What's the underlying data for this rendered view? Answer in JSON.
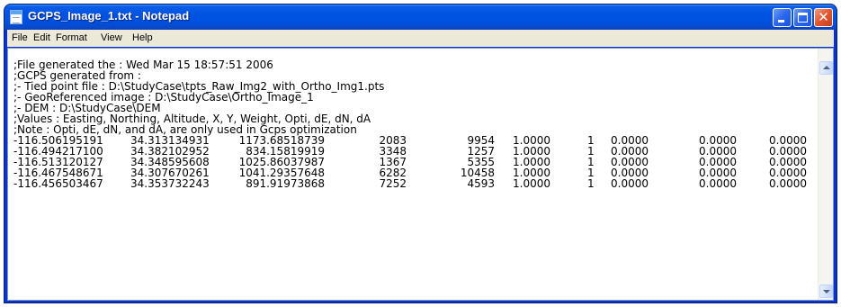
{
  "window": {
    "title": "GCPS_Image_1.txt - Notepad"
  },
  "menu": [
    "File",
    "Edit",
    "Format",
    "View",
    "Help"
  ],
  "document": {
    "header_lines": [
      ";File generated the : Wed Mar 15 18:57:51 2006",
      ";GCPS generated from :",
      ";- Tied point file : D:\\StudyCase\\tpts_Raw_Img2_with_Ortho_Img1.pts",
      ";- GeoReferenced image : D:\\StudyCase\\Ortho_Image_1",
      ";- DEM : D:\\StudyCase\\DEM",
      ";Values : Easting, Northing, Altitude, X, Y, Weight, Opti, dE, dN, dA",
      ";Note : Opti, dE, dN, and dA, are only used in Gcps optimization"
    ],
    "rows": [
      [
        "-116.506195191",
        "34.313134931",
        "1173.68518739",
        "2083",
        "9954",
        "1.0000",
        "1",
        "0.0000",
        "0.0000",
        "0.0000"
      ],
      [
        "-116.494217100",
        "34.382102952",
        "834.15819919",
        "3348",
        "1257",
        "1.0000",
        "1",
        "0.0000",
        "0.0000",
        "0.0000"
      ],
      [
        "-116.513120127",
        "34.348595608",
        "1025.86037987",
        "1367",
        "5355",
        "1.0000",
        "1",
        "0.0000",
        "0.0000",
        "0.0000"
      ],
      [
        "-116.467548671",
        "34.307670261",
        "1041.29357648",
        "6282",
        "10458",
        "1.0000",
        "1",
        "0.0000",
        "0.0000",
        "0.0000"
      ],
      [
        "-116.456503467",
        "34.353732243",
        "891.91973868",
        "7252",
        "4593",
        "1.0000",
        "1",
        "0.0000",
        "0.0000",
        "0.0000"
      ]
    ]
  }
}
